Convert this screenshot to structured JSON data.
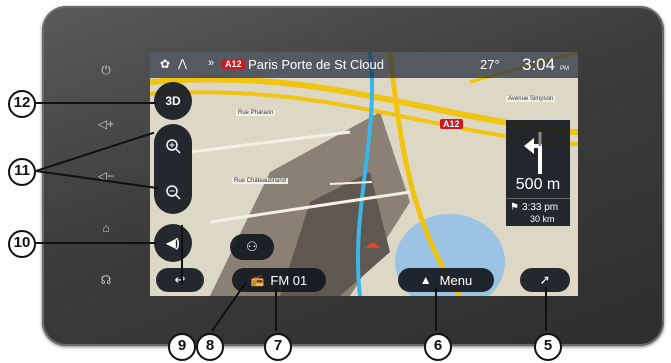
{
  "topbar": {
    "road_badge": "A12",
    "destination": "Paris Porte de St Cloud",
    "temperature": "27°",
    "clock": "3:04",
    "clock_suffix": "PM"
  },
  "map_labels": {
    "road_a12": "A12",
    "street_1": "Rue Pharaon",
    "street_2": "Rue Châteaubriand",
    "street_3": "Avenue Simpson"
  },
  "controls": {
    "view_3d": "3D",
    "media_source": "FM 01",
    "menu_label": "Menu"
  },
  "guidance": {
    "distance": "500 m",
    "arrival_time": "3:33 pm",
    "remaining": "30 km"
  },
  "callouts": [
    "12",
    "11",
    "10",
    "9",
    "8",
    "7",
    "6",
    "5"
  ]
}
